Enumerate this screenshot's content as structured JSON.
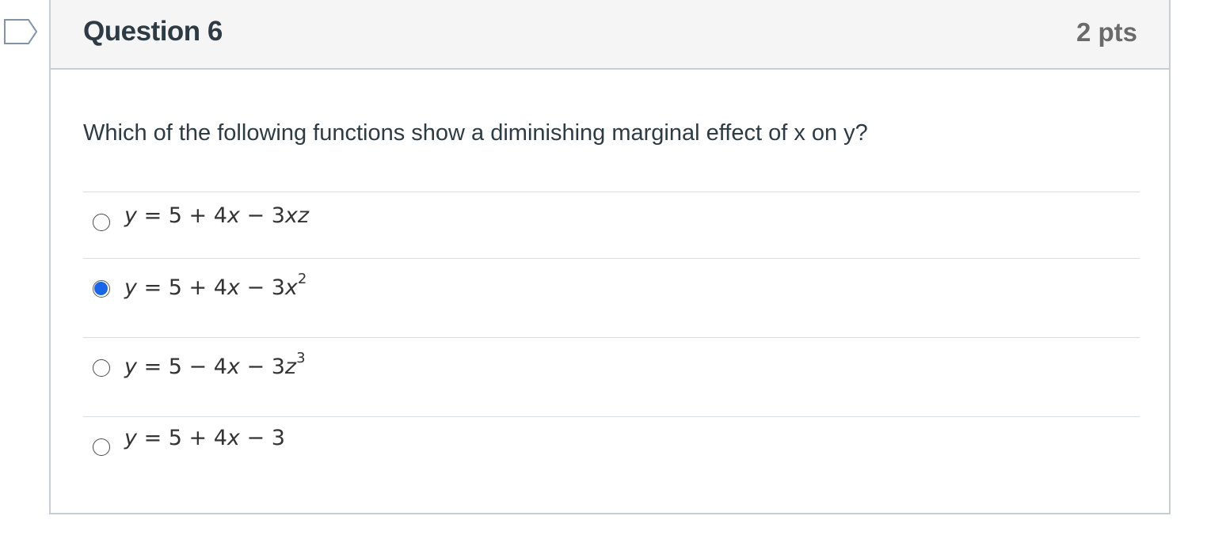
{
  "question": {
    "title": "Question 6",
    "points": "2 pts",
    "text": "Which of the following functions show a diminishing marginal effect of x on y?",
    "flag_icon": "flag-outline-icon"
  },
  "answers": [
    {
      "formula_prefix": "y = 5 + 4",
      "formula_parts": [
        "y",
        " = 5 + 4",
        "x",
        " − 3",
        "xz"
      ],
      "selected": false
    },
    {
      "formula_parts": [
        "y",
        " = 5 + 4",
        "x",
        " − 3",
        "x",
        "2"
      ],
      "selected": true
    },
    {
      "formula_parts": [
        "y",
        " = 5 − 4",
        "x",
        " − 3",
        "z",
        "3"
      ],
      "selected": false
    },
    {
      "formula_parts": [
        "y",
        " = 5 + 4",
        "x",
        " − 3"
      ],
      "selected": false
    }
  ],
  "colors": {
    "header_bg": "#f5f5f5",
    "border": "#c7cdd1",
    "text": "#2d3b45",
    "points": "#6b6b6b",
    "radio_selected": "#1a66e8",
    "flag": "#8093a8"
  }
}
